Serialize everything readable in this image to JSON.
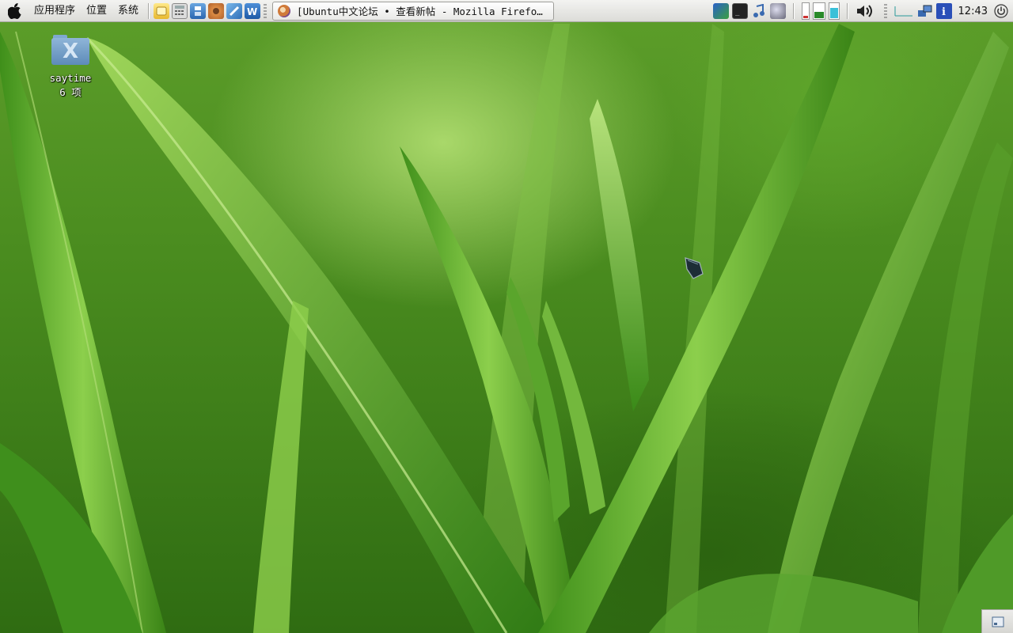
{
  "panel": {
    "menus": [
      "应用程序",
      "位置",
      "系统"
    ],
    "launchers": [
      "notes-icon",
      "calculator-icon",
      "save-disk-icon",
      "gimp-icon",
      "shell-icon",
      "writer-icon"
    ],
    "task_title": "[Ubuntu中文论坛 • 查看新帖 - Mozilla Firefo…",
    "tray_icons": [
      "network-manager-icon",
      "terminal-icon",
      "music-icon",
      "weather-icon"
    ],
    "clock": "12:43",
    "colors": {
      "panel_top": "#f3f3f1",
      "panel_bottom": "#dcdcd8"
    }
  },
  "desktop": {
    "icon_name": "saytime",
    "icon_count": "6 项",
    "folder_glyph": "X"
  },
  "meters": {
    "cpu": 0.15,
    "mem": 0.45,
    "net": 0.7
  }
}
